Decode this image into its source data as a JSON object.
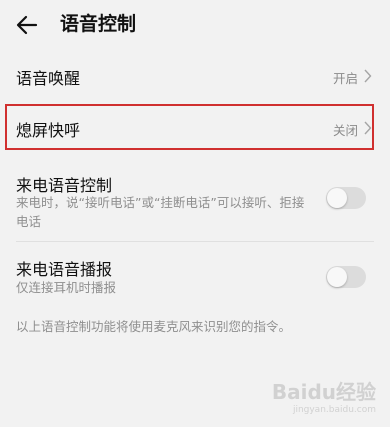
{
  "header": {
    "title": "语音控制"
  },
  "rows": {
    "voice_wakeup": {
      "title": "语音唤醒",
      "value": "开启"
    },
    "quick_call": {
      "title": "熄屏快呼",
      "value": "关闭"
    },
    "incoming_call_control": {
      "title": "来电语音控制",
      "desc": "来电时，说“接听电话”或“挂断电话”可以接听、拒接电话",
      "enabled": false
    },
    "incoming_call_broadcast": {
      "title": "来电语音播报",
      "desc": "仅连接耳机时播报",
      "enabled": false
    }
  },
  "footer": {
    "note": "以上语音控制功能将使用麦克风来识别您的指令。"
  },
  "watermark": {
    "main": "Baidu经验",
    "sub": "jingyan.baidu.com"
  },
  "colors": {
    "background": "#f2f2f2",
    "highlight": "#d0302f",
    "toggle_off": "#dcdcdc"
  }
}
